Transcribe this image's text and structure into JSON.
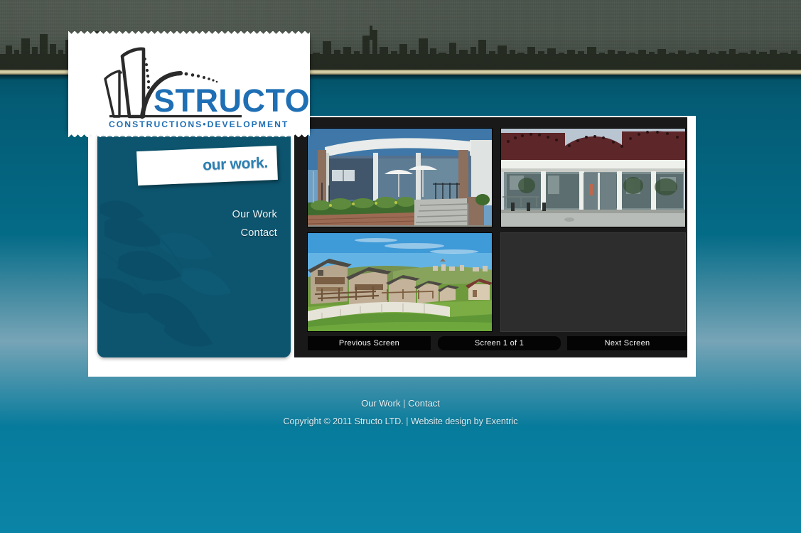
{
  "site": {
    "brand_name": "STRUCTO",
    "brand_tagline": "CONSTRUCTIONS•DEVELOPMENT",
    "accent_color": "#2c7fb2",
    "sidebar_color": "#0d556f",
    "header_stripe_color": "#ded7af"
  },
  "page": {
    "title": "our work."
  },
  "sidebar": {
    "items": [
      {
        "label": "Our Work"
      },
      {
        "label": "Contact"
      }
    ]
  },
  "gallery": {
    "thumbnails": [
      {
        "caption": "Modern glass-front villa with stone-clad steps and garden beds",
        "empty": false
      },
      {
        "caption": "Commercial building with dark red barrel-vault roofs and glass storefront",
        "empty": false
      },
      {
        "caption": "Row of stone houses on a green hillside under blue sky",
        "empty": false
      },
      {
        "caption": "",
        "empty": true
      }
    ],
    "controls": {
      "previous_label": "Previous Screen",
      "counter_label": "Screen 1 of 1",
      "next_label": "Next Screen"
    }
  },
  "footer": {
    "links": [
      {
        "label": "Our Work"
      },
      {
        "label": "Contact"
      }
    ],
    "separator": "|",
    "copyright_prefix": "Copyright © 2011 Structo LTD.",
    "credit_prefix": "Website design by",
    "credit_name": "Exentric"
  }
}
